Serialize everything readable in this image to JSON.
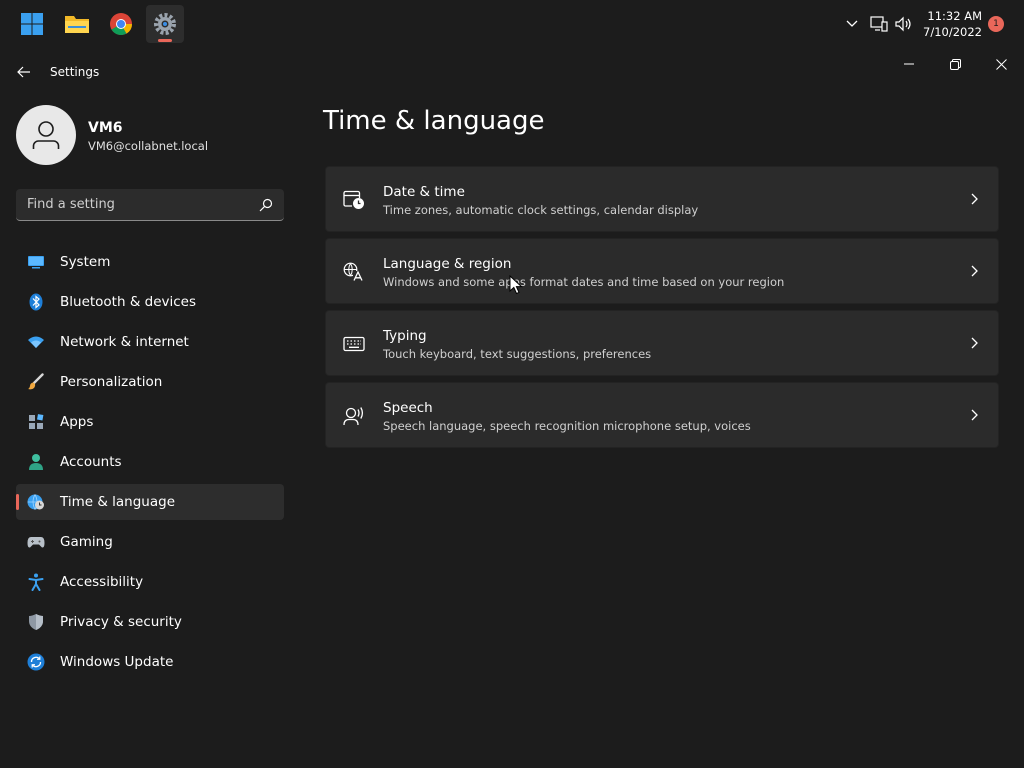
{
  "taskbar": {
    "apps": [
      "start-button",
      "file-explorer",
      "chrome",
      "settings"
    ],
    "time": "11:32 AM",
    "date": "7/10/2022",
    "notification_count": "1"
  },
  "window": {
    "title": "Settings"
  },
  "profile": {
    "name": "VM6",
    "email": "VM6@collabnet.local"
  },
  "search": {
    "placeholder": "Find a setting"
  },
  "sidebar": {
    "items": [
      {
        "label": "System",
        "icon": "monitor-icon"
      },
      {
        "label": "Bluetooth & devices",
        "icon": "bluetooth-icon"
      },
      {
        "label": "Network & internet",
        "icon": "wifi-icon"
      },
      {
        "label": "Personalization",
        "icon": "brush-icon"
      },
      {
        "label": "Apps",
        "icon": "apps-icon"
      },
      {
        "label": "Accounts",
        "icon": "person-icon"
      },
      {
        "label": "Time & language",
        "icon": "globe-clock-icon",
        "selected": true
      },
      {
        "label": "Gaming",
        "icon": "gamepad-icon"
      },
      {
        "label": "Accessibility",
        "icon": "accessibility-icon"
      },
      {
        "label": "Privacy & security",
        "icon": "shield-icon"
      },
      {
        "label": "Windows Update",
        "icon": "update-icon"
      }
    ]
  },
  "main": {
    "title": "Time & language",
    "cards": [
      {
        "title": "Date & time",
        "desc": "Time zones, automatic clock settings, calendar display",
        "icon": "calendar-clock-icon"
      },
      {
        "title": "Language & region",
        "desc": "Windows and some apps format dates and time based on your region",
        "icon": "language-icon"
      },
      {
        "title": "Typing",
        "desc": "Touch keyboard, text suggestions, preferences",
        "icon": "keyboard-icon"
      },
      {
        "title": "Speech",
        "desc": "Speech language, speech recognition microphone setup, voices",
        "icon": "speech-icon"
      }
    ]
  },
  "colors": {
    "accent": "#e9675a",
    "background": "#1c1c1c",
    "card": "#2b2b2b"
  }
}
